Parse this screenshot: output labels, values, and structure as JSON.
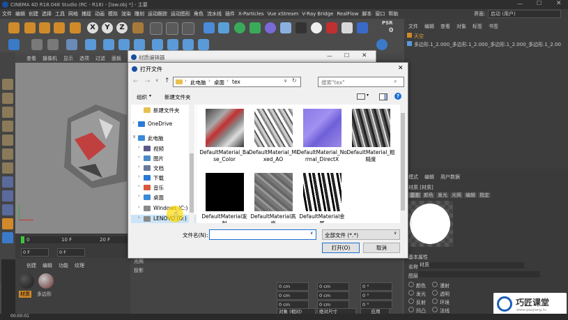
{
  "app": {
    "title": "CINEMA 4D R18.048 Studio (RC - R18) - [law.obj *] - 主要",
    "menu": [
      "文件",
      "编辑",
      "创建",
      "选择",
      "工具",
      "网格",
      "捕捉",
      "动画",
      "模拟",
      "渲染",
      "雕刻",
      "运动跟踪",
      "运动图形",
      "角色",
      "流水线",
      "插件",
      "X-Particles",
      "Vue xStream",
      "V-Ray Bridge",
      "RealFlow",
      "脚本",
      "窗口",
      "帮助"
    ],
    "layout_label": "界面:",
    "layout_value": "启动 (用户)"
  },
  "toolbar": {
    "axis_x": "X",
    "axis_y": "Y",
    "axis_z": "Z",
    "psr_label": "PSR",
    "psr_value": "0"
  },
  "viewport": {
    "menu": [
      "查看",
      "摄像机",
      "显示",
      "选项",
      "过滤",
      "面板"
    ]
  },
  "timeline": {
    "ticks": [
      "0",
      "10 F",
      "20 F"
    ],
    "current_frame": "0 F",
    "start_frame": "0 F"
  },
  "material_panel": {
    "menu": [
      "创建",
      "编辑",
      "功能",
      "纹理"
    ],
    "materials": [
      {
        "name": "材质"
      },
      {
        "name": "多边形"
      }
    ]
  },
  "coord_panel": {
    "labels": [
      "光照",
      "投影"
    ],
    "x_pos": "0 cm",
    "y_pos": "0 cm",
    "z_pos": "0 cm",
    "x_size": "0 cm",
    "y_size": "0 cm",
    "z_size": "0 cm",
    "h": "0 °",
    "p": "0 °",
    "b": "0 °",
    "mode_select": "对象 (相对)",
    "size_select": "绝对尺寸",
    "apply": "应用"
  },
  "right_panel": {
    "obj_menu": [
      "文件",
      "编辑",
      "查看",
      "对象",
      "标签",
      "书签"
    ],
    "objects": [
      "天空",
      "多边形.1_2.000_多边形.1_2.000_多边形.1_2.000_多边形.1_2.00"
    ],
    "attr_menu": [
      "模式",
      "编辑",
      "用户数据"
    ],
    "material_title": "材质 [材质]",
    "tabs": [
      "基本",
      "颜色",
      "发光",
      "光照",
      "编辑",
      "指定"
    ],
    "basic_props": "基本属性",
    "name_label": "名称",
    "name_value": "材质",
    "layer_label": "图层",
    "channels_left": [
      "颜色",
      "发光",
      "反射",
      "凹凸"
    ],
    "channels_right": [
      "漫射",
      "透明",
      "环境",
      "法线"
    ]
  },
  "material_editor": {
    "title": "材质编辑器"
  },
  "dialog": {
    "title": "打开文件",
    "path": [
      "此电脑",
      "桌面",
      "tex"
    ],
    "search_placeholder": "搜索\"tex\"",
    "organize": "组织",
    "new_folder": "新建文件夹",
    "nav": [
      {
        "label": "新建文件夹",
        "icon": "folder-icon"
      },
      {
        "label": "OneDrive",
        "icon": "cloud-icon"
      },
      {
        "label": "此电脑",
        "icon": "computer-icon"
      },
      {
        "label": "视频",
        "icon": "video-icon"
      },
      {
        "label": "图片",
        "icon": "picture-icon"
      },
      {
        "label": "文档",
        "icon": "document-icon"
      },
      {
        "label": "下载",
        "icon": "download-icon"
      },
      {
        "label": "音乐",
        "icon": "music-icon"
      },
      {
        "label": "桌面",
        "icon": "desktop-icon"
      },
      {
        "label": "Windows (C:)",
        "icon": "drive-icon"
      },
      {
        "label": "LENOVO (D:)",
        "icon": "drive-icon"
      }
    ],
    "files": [
      {
        "name": "DefaultMaterial_Base_Color"
      },
      {
        "name": "DefaultMaterial_Mixed_AO"
      },
      {
        "name": "DefaultMaterial_Normal_DirectX"
      },
      {
        "name": "DefaultMaterial_粗糙度"
      },
      {
        "name": "DefaultMaterial发射"
      },
      {
        "name": "DefaultMaterial高度"
      },
      {
        "name": "DefaultMaterial金属"
      }
    ],
    "filename_label": "文件名(N):",
    "filename_value": "",
    "filter_value": "全部文件 (*.*)",
    "open_button": "打开(O)",
    "cancel_button": "取消"
  },
  "watermark": {
    "brand": "巧匠课堂",
    "url": "www.qiaojiang.tv"
  },
  "status": {
    "time": "00:00:01"
  },
  "colors": {
    "c4d_bg": "#4a4a4a",
    "dialog_bg": "#f0f0f0",
    "selection_blue": "#1a5fb4",
    "accent_orange": "#e8a030"
  }
}
